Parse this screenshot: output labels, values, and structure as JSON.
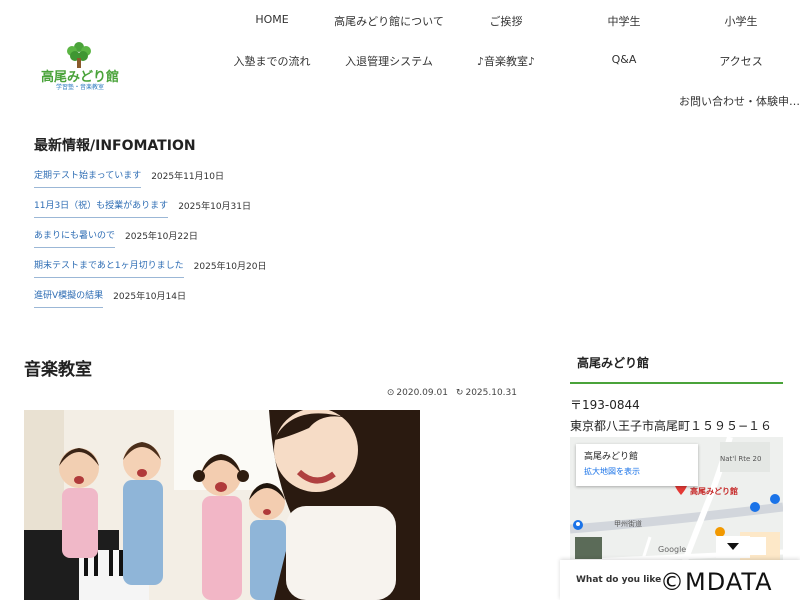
{
  "logo": {
    "name": "高尾みどり館",
    "sub": "学習塾・音楽教室"
  },
  "nav": {
    "row1": [
      "HOME",
      "高尾みどり館について",
      "ご挨拶",
      "中学生",
      "小学生"
    ],
    "row2": [
      "入塾までの流れ",
      "入退管理システム",
      "♪音楽教室♪",
      "Q&A",
      "アクセス"
    ],
    "extra": "お問い合わせ・体験申…"
  },
  "news": {
    "title": "最新情報/INFOMATION",
    "items": [
      {
        "text": "定期テスト始まっています",
        "date": "2025年11月10日"
      },
      {
        "text": "11月3日（祝）も授業があります",
        "date": "2025年10月31日"
      },
      {
        "text": "あまりにも暑いので",
        "date": "2025年10月22日"
      },
      {
        "text": "期末テストまであと1ヶ月切りました",
        "date": "2025年10月20日"
      },
      {
        "text": "進研V模擬の結果",
        "date": "2025年10月14日"
      }
    ]
  },
  "article": {
    "title": "音楽教室",
    "published": "2020.09.01",
    "updated": "2025.10.31"
  },
  "sidebar": {
    "title": "高尾みどり館",
    "zip": "〒193-0844",
    "address": "東京都八王子市高尾町１５９５−１６"
  },
  "map": {
    "place_name": "高尾みどり館",
    "enlarge_link": "拡大地図を表示",
    "pin_label": "高尾みどり館",
    "road_label": "甲州街道",
    "route_label": "Nat'l Rte 20",
    "google": "Google"
  },
  "chat": {
    "question": "What do you like"
  },
  "copyright": "©MDATA",
  "colors": {
    "brand_green": "#4aa33a",
    "link_blue": "#2e6db4",
    "map_pin": "#e53935"
  }
}
